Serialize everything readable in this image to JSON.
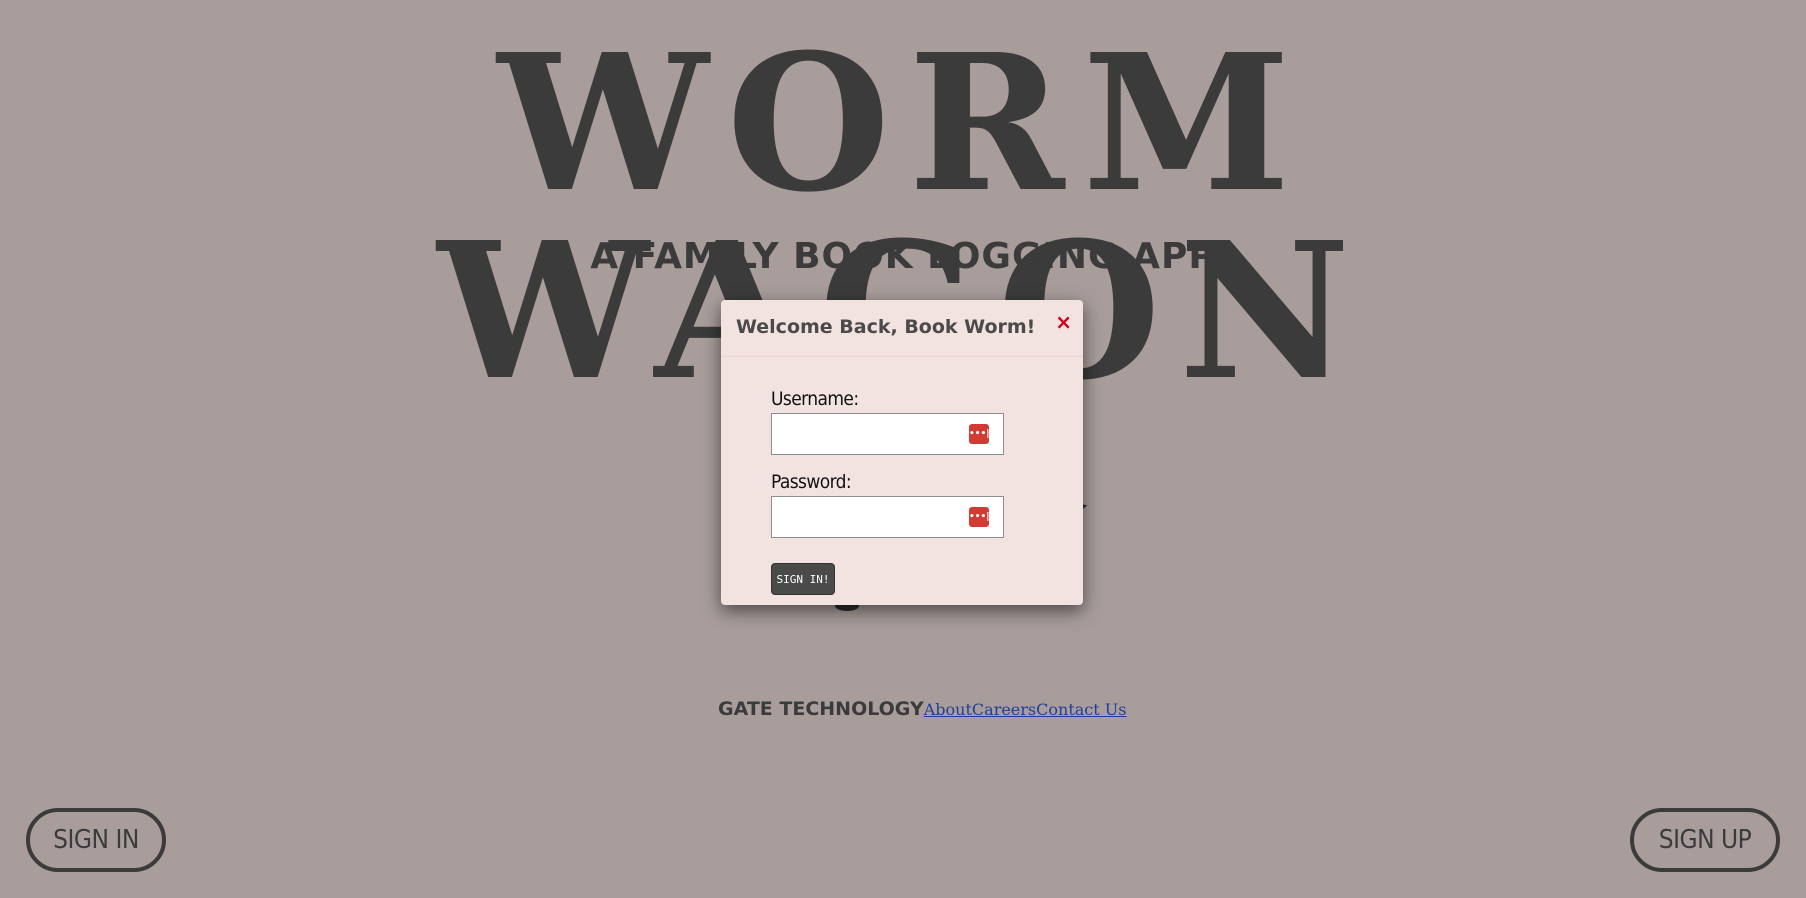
{
  "hero": {
    "title": "WORM WAGON",
    "subtitle": "A FAMILY BOOK LOGGING APP"
  },
  "modal": {
    "title": "Welcome Back, Book Worm!",
    "close_glyph": "×",
    "username_label": "Username:",
    "username_value": "",
    "password_label": "Password:",
    "password_value": "",
    "manager_icon_glyph": "•••|",
    "submit_label": "SIGN IN!"
  },
  "footer": {
    "brand": "GATE TECHNOLOGY",
    "links": [
      "About",
      "Careers",
      "Contact Us"
    ]
  },
  "buttons": {
    "sign_in": "SIGN IN",
    "sign_up": "SIGN UP"
  },
  "colors": {
    "background": "#a89d9b",
    "text": "#3b3b3b",
    "modal_bg": "#f2e3e1",
    "close": "#d0021b",
    "link": "#1f3f9a",
    "password_manager_icon": "#d23a34"
  },
  "icons": {
    "close": "close-icon",
    "password_manager": "password-manager-icon",
    "illustration": "book-stack-wagon-illustration"
  }
}
